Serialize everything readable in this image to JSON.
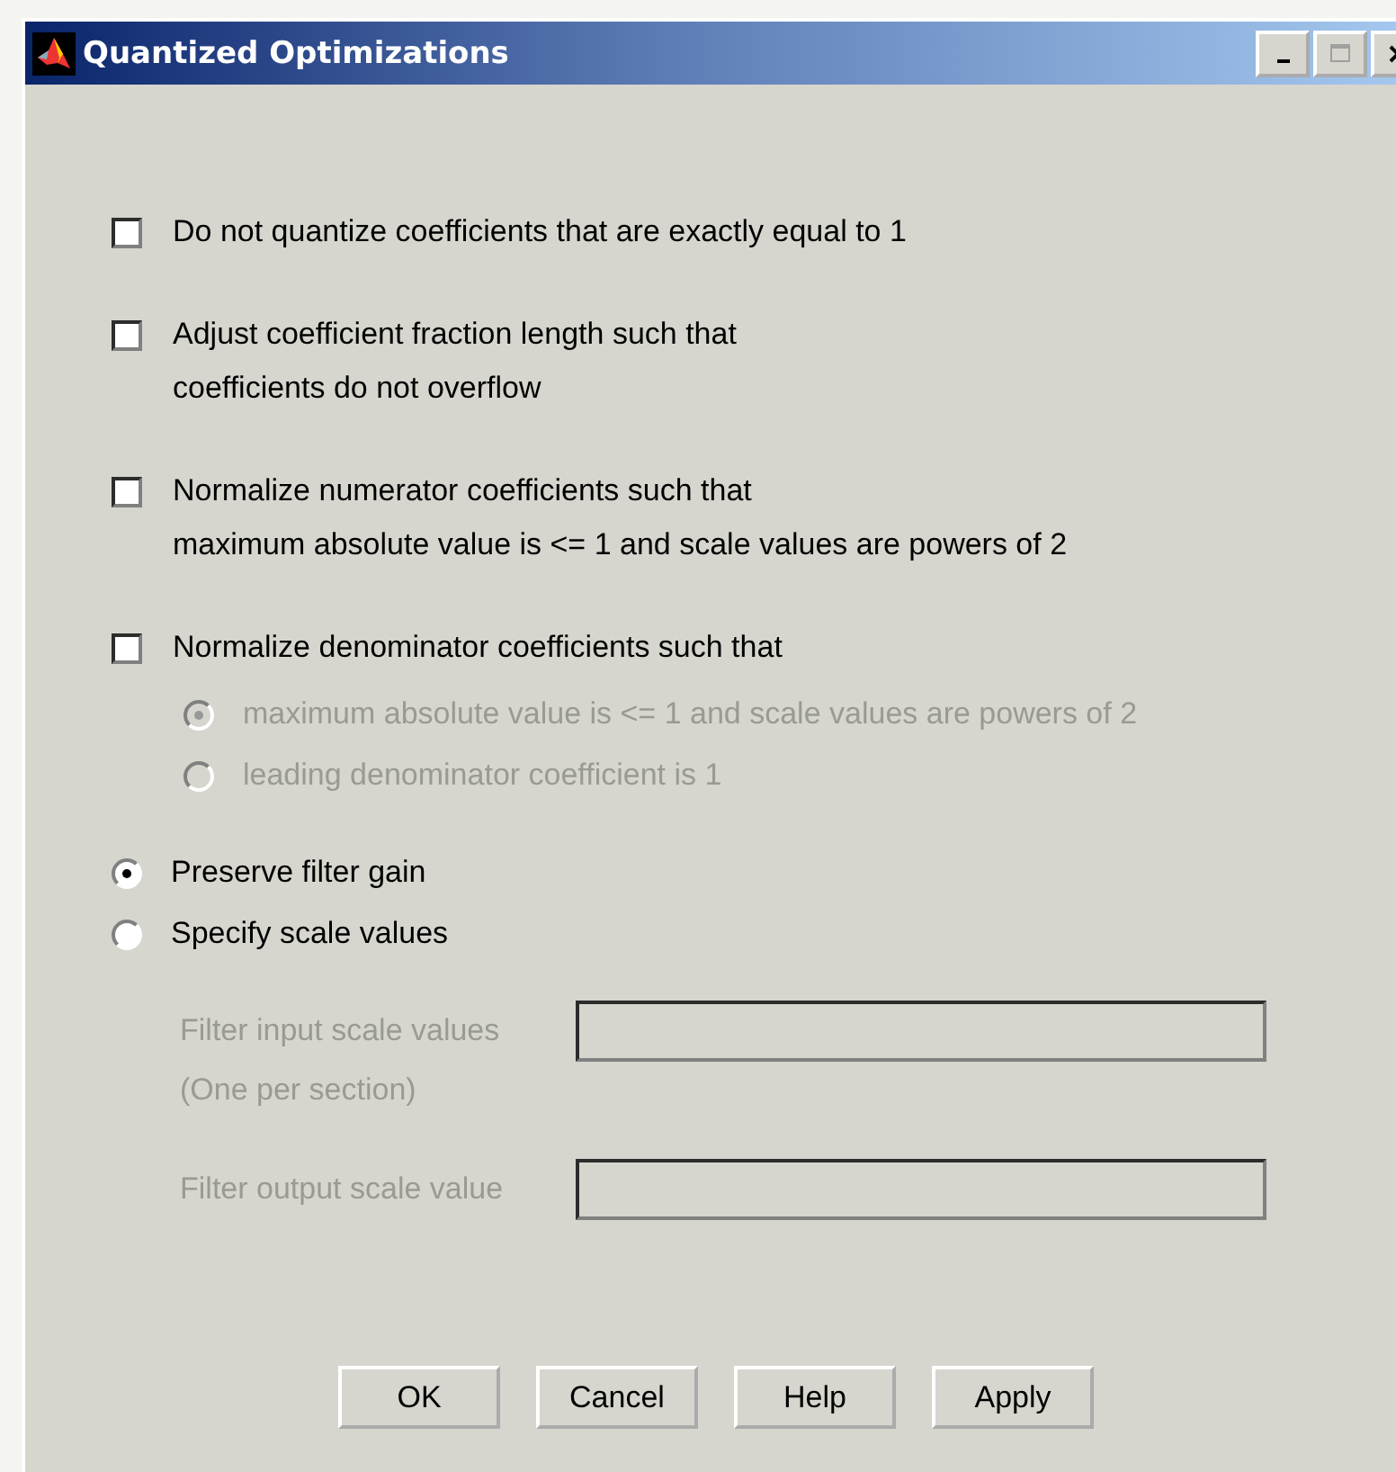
{
  "window": {
    "title": "Quantized Optimizations"
  },
  "options": [
    {
      "label": "Do not quantize coefficients that are exactly equal to 1",
      "checked": false
    },
    {
      "label": "Adjust coefficient fraction length such that\ncoefficients do not overflow",
      "checked": false
    },
    {
      "label": "Normalize numerator coefficients such that\nmaximum absolute value is <= 1 and scale values are powers of 2",
      "checked": false
    },
    {
      "label": "Normalize denominator coefficients such that",
      "checked": false,
      "suboptions": [
        {
          "label": "maximum absolute value is <= 1 and scale values are powers of 2",
          "selected": true,
          "disabled": true
        },
        {
          "label": "leading denominator coefficient is 1",
          "selected": false,
          "disabled": true
        }
      ]
    }
  ],
  "scaling": [
    {
      "label": "Preserve filter gain",
      "selected": true
    },
    {
      "label": "Specify scale values",
      "selected": false
    }
  ],
  "scale_fields": [
    {
      "label": "Filter input scale values",
      "note": "(One per section)",
      "disabled": true
    },
    {
      "label": "Filter output scale value",
      "disabled": true
    }
  ],
  "buttons": [
    "OK",
    "Cancel",
    "Help",
    "Apply"
  ]
}
